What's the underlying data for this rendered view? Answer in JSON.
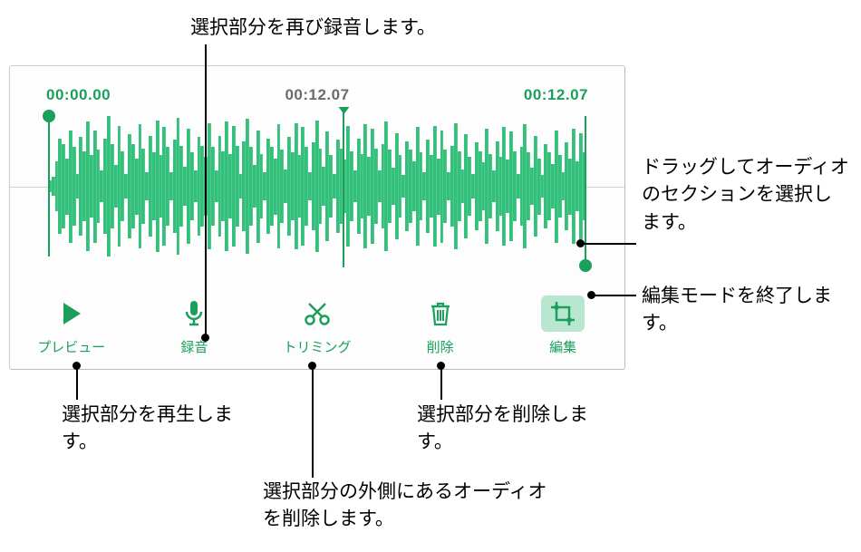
{
  "callouts": {
    "record_again": "選択部分を再び録音します。",
    "drag_select": "ドラッグしてオーディオのセクションを選択します。",
    "exit_edit": "編集モードを終了します。",
    "play_selection": "選択部分を再生します。",
    "delete_selection": "選択部分を削除します。",
    "trim_outside": "選択部分の外側にあるオーディオを削除します。"
  },
  "timecodes": {
    "start": "00:00.00",
    "current": "00:12.07",
    "end": "00:12.07"
  },
  "toolbar": {
    "preview": "プレビュー",
    "record": "録音",
    "trim": "トリミング",
    "delete": "削除",
    "edit": "編集"
  },
  "accent": "#1aa05a",
  "waveform_samples": [
    8,
    14,
    36,
    68,
    60,
    40,
    80,
    56,
    18,
    70,
    50,
    92,
    44,
    80,
    52,
    22,
    68,
    100,
    60,
    30,
    86,
    50,
    18,
    74,
    60,
    40,
    88,
    54,
    20,
    72,
    48,
    94,
    44,
    84,
    56,
    20,
    66,
    98,
    58,
    28,
    82,
    48,
    22,
    70,
    58,
    42,
    90,
    56,
    22,
    72,
    50,
    92,
    46,
    86,
    58,
    18,
    64,
    96,
    56,
    30,
    80,
    46,
    20,
    68,
    56,
    40,
    88,
    52,
    24,
    70,
    48,
    90,
    44,
    84,
    56,
    20,
    62,
    94,
    54,
    28,
    78,
    44,
    18,
    66,
    54,
    38,
    86,
    50,
    22,
    68,
    46,
    88,
    42,
    82,
    54,
    22,
    60,
    92,
    52,
    26,
    76,
    44,
    16,
    64,
    52,
    36,
    84,
    48,
    20,
    66,
    44,
    86,
    40,
    80,
    52,
    20,
    58,
    90,
    50,
    24,
    74,
    42,
    18,
    62,
    50,
    34,
    82,
    46,
    22,
    64,
    42,
    84,
    38,
    78,
    50,
    18,
    56,
    88,
    48,
    26,
    72,
    40,
    16,
    60,
    48,
    32,
    80,
    44,
    20,
    62,
    40,
    82,
    36,
    76,
    48
  ]
}
